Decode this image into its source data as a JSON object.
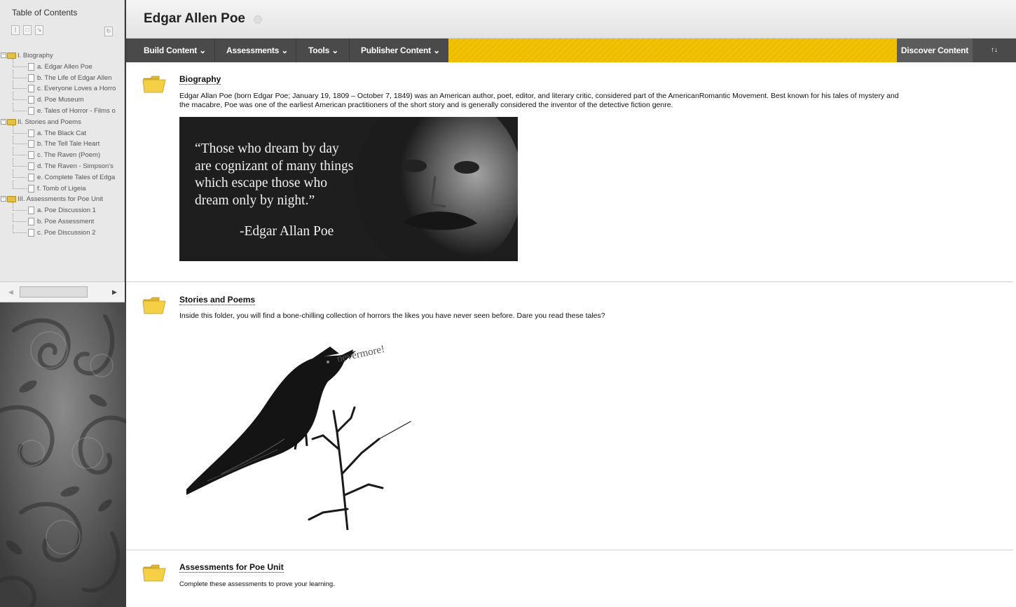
{
  "sidebar": {
    "title": "Table of Contents",
    "tree": [
      {
        "type": "folder",
        "label": "I. Biography"
      },
      {
        "type": "item",
        "label": "a. Edgar Allen Poe"
      },
      {
        "type": "item",
        "label": "b. The Life of Edgar Allen"
      },
      {
        "type": "item",
        "label": "c. Everyone Loves a Horro"
      },
      {
        "type": "item",
        "label": "d. Poe Museum"
      },
      {
        "type": "item",
        "label": "e. Tales of Horror - Films o"
      },
      {
        "type": "folder",
        "label": "II. Stories and Poems"
      },
      {
        "type": "item",
        "label": "a. The Black Cat"
      },
      {
        "type": "item",
        "label": "b. The Tell Tale Heart"
      },
      {
        "type": "item",
        "label": "c. The Raven (Poem)"
      },
      {
        "type": "item",
        "label": "d. The Raven - Simpson's"
      },
      {
        "type": "item",
        "label": "e. Complete Tales of Edga"
      },
      {
        "type": "item",
        "label": "f. Tomb of Ligeia"
      },
      {
        "type": "folder",
        "label": "III. Assessments for Poe Unit"
      },
      {
        "type": "item",
        "label": "a. Poe Discussion 1"
      },
      {
        "type": "item",
        "label": "b. Poe Assessment"
      },
      {
        "type": "item",
        "label": "c. Poe Discussion 2"
      }
    ]
  },
  "header": {
    "title": "Edgar Allen Poe"
  },
  "toolbar": {
    "build_content": "Build Content",
    "assessments": "Assessments",
    "tools": "Tools",
    "publisher_content": "Publisher Content",
    "discover_content": "Discover Content",
    "sort_icon": "↑↓",
    "accent_color": "#f0c200"
  },
  "items": {
    "biography": {
      "title": "Biography",
      "desc_line1": "Edgar Allan Poe (born Edgar Poe; January 19, 1809 – October 7, 1849) was an American author, poet, editor, and literary critic, considered part of the AmericanRomantic Movement. Best known for his tales of mystery and",
      "desc_line2": "the macabre, Poe was one of the earliest American practitioners of the short story and is generally considered the inventor of the detective fiction genre.",
      "quote_lines": [
        "“Those who dream by day",
        "are cognizant of many things",
        "which escape those who",
        "dream only by night.”"
      ],
      "quote_author": "-Edgar Allan Poe"
    },
    "stories": {
      "title": "Stories and Poems",
      "desc": "Inside this folder, you will find a bone-chilling collection of horrors the likes you have never seen before. Dare you read these tales?",
      "raven_caption": "nevermore!"
    },
    "assessments": {
      "title": "Assessments for Poe Unit",
      "desc": "Complete these assessments to prove your learning."
    }
  }
}
